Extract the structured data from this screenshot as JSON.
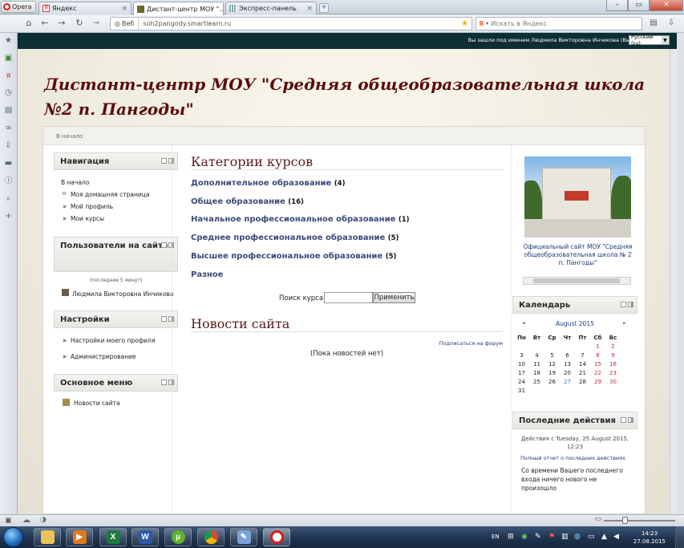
{
  "browser": {
    "menu_label": "Opera",
    "tabs": [
      {
        "label": "Яндекс"
      },
      {
        "label": "Дистант-центр МОУ \"..."
      },
      {
        "label": "Экспресс-панель"
      }
    ],
    "new_tab": "+",
    "web_label": "Веб",
    "url": "soh2pangody.smartlearn.ru",
    "search_placeholder": "Искать в Яндекс",
    "search_brand": "Я"
  },
  "page": {
    "login_info": "Вы зашли под именем Людмила Викторовна Инчикова (Выход)",
    "language": "Русский (ru)",
    "site_title": "Дистант-центр МОУ \"Средняя общеобразовательная школа №2 п. Пангоды\"",
    "breadcrumb": "В начало",
    "navigation": {
      "title": "Навигация",
      "home": "В начало",
      "items": [
        "Моя домашняя страница",
        "Мой профиль",
        "Мои курсы"
      ]
    },
    "online_users": {
      "title": "Пользователи на сайте",
      "period": "(последние 5 минут)",
      "users": [
        "Людмила Викторовна Инчикова"
      ]
    },
    "settings": {
      "title": "Настройки",
      "items": [
        "Настройки моего профиля",
        "Администрирование"
      ]
    },
    "main_menu": {
      "title": "Основное меню",
      "items": [
        "Новости сайта"
      ]
    },
    "course_categories": {
      "title": "Категории курсов",
      "items": [
        {
          "name": "Дополнительное образование",
          "count": "(4)"
        },
        {
          "name": "Общее образование",
          "count": "(16)"
        },
        {
          "name": "Начальное профессиональное образование",
          "count": "(1)"
        },
        {
          "name": "Среднее профессиональное образование",
          "count": "(5)"
        },
        {
          "name": "Высшее профессиональное образование",
          "count": "(5)"
        },
        {
          "name": "Разное",
          "count": ""
        }
      ]
    },
    "course_search": {
      "label": "Поиск курса:",
      "button": "Применить"
    },
    "news": {
      "title": "Новости сайта",
      "subscribe": "Подписаться на форум",
      "empty": "(Пока новостей нет)"
    },
    "official_site": {
      "caption": "Официальный сайт МОУ \"Средняя общеобразовательная школа № 2 п. Пангоды\""
    },
    "calendar": {
      "title": "Календарь",
      "month": "August 2015",
      "prev": "◄",
      "next": "►",
      "weekdays": [
        "Пн",
        "Вт",
        "Ср",
        "Чт",
        "Пт",
        "Сб",
        "Вс"
      ],
      "leading_blanks": 5,
      "days": 31,
      "today": 27
    },
    "recent_activity": {
      "title": "Последние действия",
      "since": "Действия с Tuesday, 25 August 2015, 12:23",
      "full_report": "Полный отчет о последних действиях",
      "nothing_new": "Со времени Вашего последнего входа ничего нового не произошло"
    }
  },
  "taskbar": {
    "lang": "EN",
    "time": "14:23",
    "date": "27.08.2015"
  },
  "colors": {
    "topbar": "#0d2e33",
    "title": "#5c0d0d",
    "link": "#3a4a7a",
    "weekend": "#c8283a",
    "today": "#3a7acf"
  }
}
